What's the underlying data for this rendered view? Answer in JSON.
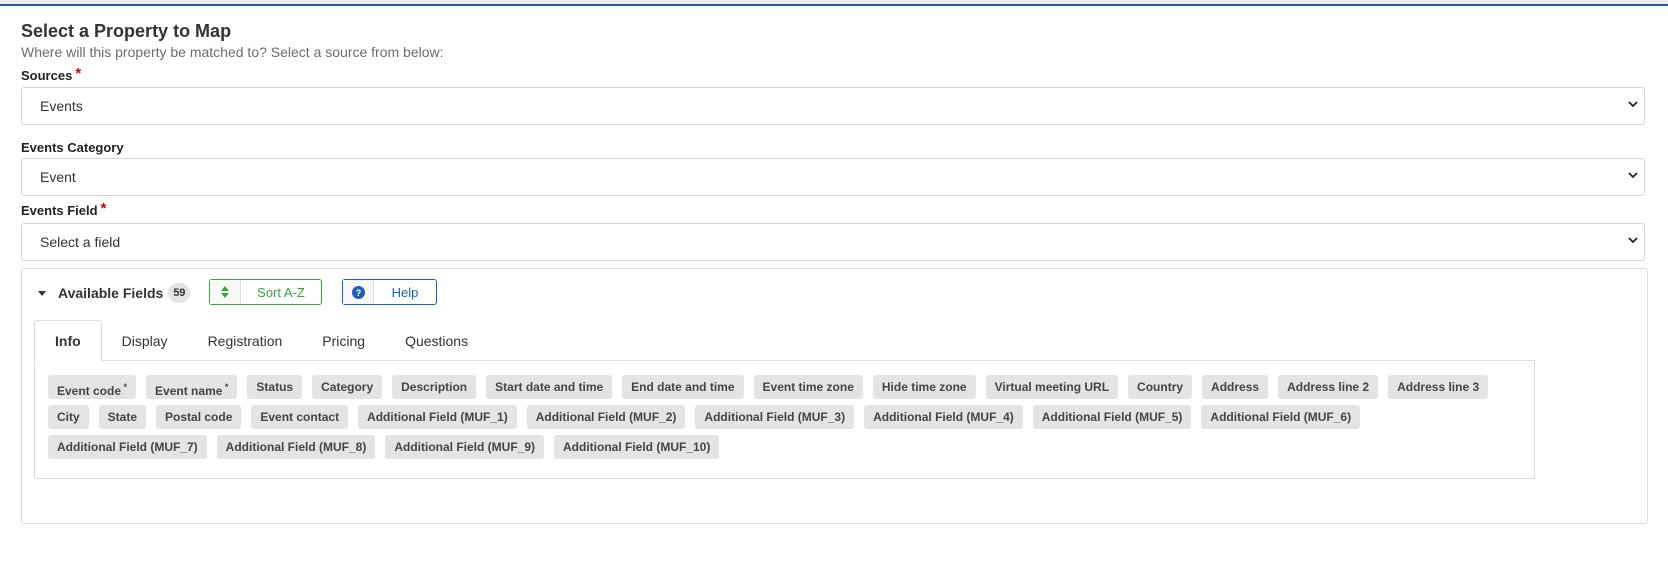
{
  "header": {
    "title": "Select a Property to Map",
    "subtitle": "Where will this property be matched to? Select a source from below:"
  },
  "sources": {
    "label": "Sources",
    "value": "Events",
    "required": true
  },
  "category": {
    "label": "Events Category",
    "value": "Event"
  },
  "field": {
    "label": "Events Field",
    "value": "Select a field",
    "required": true
  },
  "available": {
    "title": "Available Fields",
    "count": "59",
    "sort_label": "Sort A-Z",
    "help_label": "Help"
  },
  "tabs": [
    {
      "label": "Info",
      "active": true
    },
    {
      "label": "Display"
    },
    {
      "label": "Registration"
    },
    {
      "label": "Pricing"
    },
    {
      "label": "Questions"
    }
  ],
  "chips": [
    {
      "label": "Event code",
      "required": true
    },
    {
      "label": "Event name",
      "required": true
    },
    {
      "label": "Status"
    },
    {
      "label": "Category"
    },
    {
      "label": "Description"
    },
    {
      "label": "Start date and time"
    },
    {
      "label": "End date and time"
    },
    {
      "label": "Event time zone"
    },
    {
      "label": "Hide time zone"
    },
    {
      "label": "Virtual meeting URL"
    },
    {
      "label": "Country"
    },
    {
      "label": "Address"
    },
    {
      "label": "Address line 2"
    },
    {
      "label": "Address line 3"
    },
    {
      "label": "City"
    },
    {
      "label": "State"
    },
    {
      "label": "Postal code"
    },
    {
      "label": "Event contact"
    },
    {
      "label": "Additional Field (MUF_1)"
    },
    {
      "label": "Additional Field (MUF_2)"
    },
    {
      "label": "Additional Field (MUF_3)"
    },
    {
      "label": "Additional Field (MUF_4)"
    },
    {
      "label": "Additional Field (MUF_5)"
    },
    {
      "label": "Additional Field (MUF_6)"
    },
    {
      "label": "Additional Field (MUF_7)"
    },
    {
      "label": "Additional Field (MUF_8)"
    },
    {
      "label": "Additional Field (MUF_9)"
    },
    {
      "label": "Additional Field (MUF_10)"
    }
  ],
  "colors": {
    "accent": "#1f5fb4",
    "success": "#39a639",
    "required": "#d0021b",
    "chip_bg": "#e4e4e4"
  }
}
